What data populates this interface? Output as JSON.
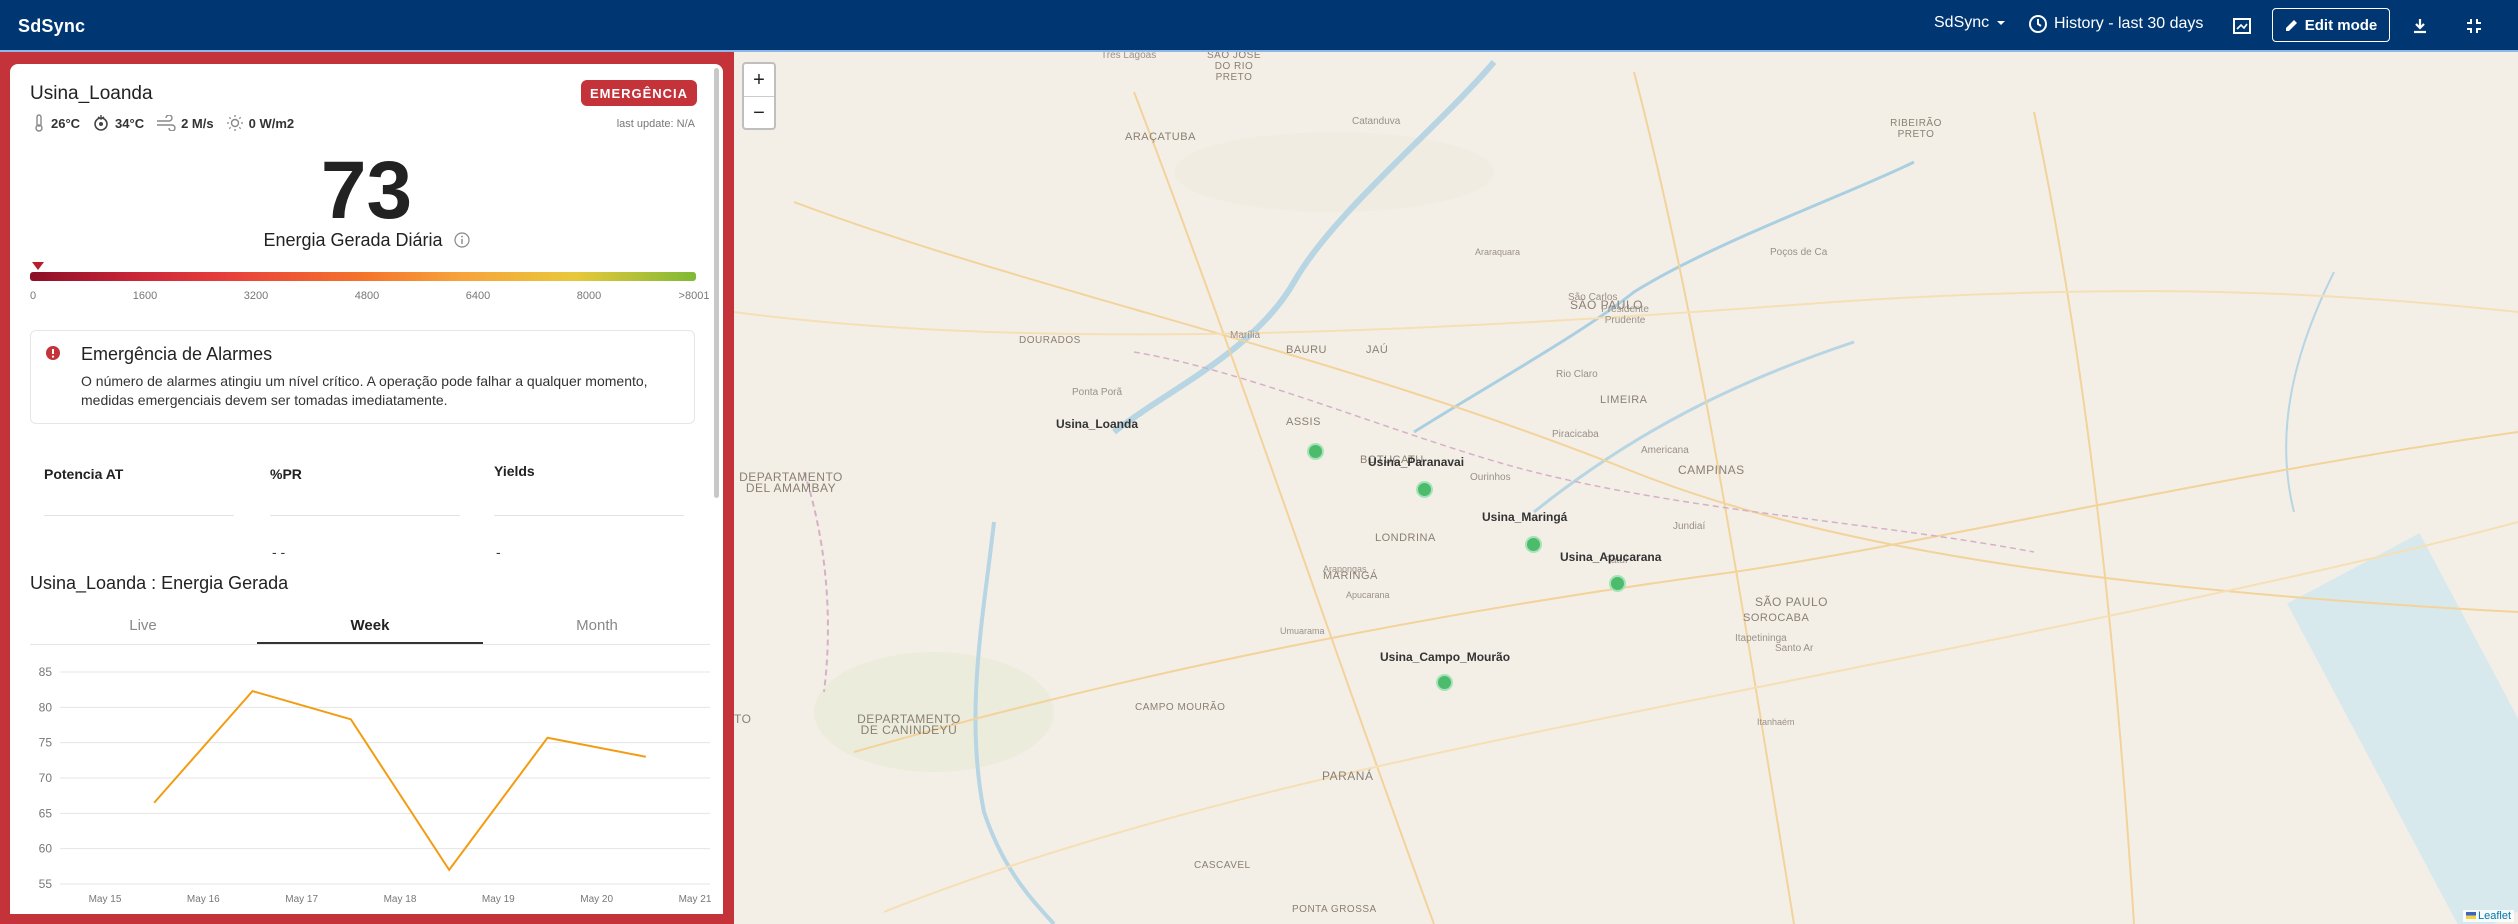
{
  "topbar": {
    "brand": "SdSync",
    "dashboard_select": "SdSync",
    "history": "History - last 30 days",
    "edit_mode": "Edit mode"
  },
  "site": {
    "name": "Usina_Loanda",
    "badge": "EMERGÊNCIA",
    "weather": {
      "temp_air": "26°C",
      "temp_module": "34°C",
      "wind": "2 M/s",
      "irradiance": "0 W/m2"
    },
    "last_update": "last update: N/A"
  },
  "gauge": {
    "value": "73",
    "label": "Energia Gerada Diária",
    "ticks": [
      "0",
      "1600",
      "3200",
      "4800",
      "6400",
      "8000",
      ">8001"
    ]
  },
  "alarm": {
    "title": "Emergência de Alarmes",
    "text": "O número de alarmes atingiu um nível crítico. A operação pode falhar a qualquer momento, medidas emergenciais devem ser tomadas imediatamente."
  },
  "kpis": [
    {
      "label": "Potencia AT",
      "value": ""
    },
    {
      "label": "%PR",
      "value": "- -"
    },
    {
      "label": "Yields",
      "value": "-"
    }
  ],
  "chart_section": {
    "title": "Usina_Loanda : Energia Gerada",
    "tabs": [
      "Live",
      "Week",
      "Month"
    ],
    "active_tab": "Week"
  },
  "chart_data": {
    "type": "line",
    "categories": [
      "May 15",
      "May 16",
      "May 17",
      "May 18",
      "May 19",
      "May 20",
      "May 21"
    ],
    "x": [
      "May 15 12:00",
      "May 16 12:00",
      "May 17 12:00",
      "May 18 12:00",
      "May 19 12:00",
      "May 20 12:00",
      "May 21 12:00"
    ],
    "series": [
      {
        "values": [
          66.5,
          82.3,
          78.3,
          57.0,
          75.7,
          73.0
        ],
        "color": "#f39c12"
      }
    ],
    "yticks": [
      "85",
      "80",
      "75",
      "70",
      "65",
      "60",
      "55"
    ],
    "ylim": [
      55,
      85
    ],
    "grid": true
  },
  "map": {
    "zoom_in": "+",
    "zoom_out": "−",
    "attribution": "Leaflet",
    "markers": [
      {
        "name": "Usina_Loanda"
      },
      {
        "name": "Usina_Paranavai"
      },
      {
        "name": "Usina_Maringá"
      },
      {
        "name": "Usina_Apucarana"
      },
      {
        "name": "Usina_Campo_Mourão"
      }
    ],
    "labels": [
      "Três Lagoas",
      "SÃO JOSÉ DO RIO PRETO",
      "Catanduva",
      "RIBEIRÃO PRETO",
      "ARAÇATUBA",
      "Araraquara",
      "Poços de Ca",
      "SÃO PAULO",
      "São Carlos",
      "Presidente Prudente",
      "Marília",
      "BAURU",
      "JAÚ",
      "Rio Claro",
      "LIMEIRA",
      "DOURADOS",
      "Ponta Porã",
      "ASSIS",
      "Ourinhos",
      "BOTUCATU",
      "Piracicaba",
      "Americana",
      "CAMPINAS",
      "DEPARTAMENTO DEL AMAMBAY",
      "LONDRINA",
      "Arapongas",
      "Apucarana",
      "Tatuí",
      "Jundiaí",
      "MARINGÁ",
      "Umuarama",
      "SOROCABA",
      "SÃO PAULO",
      "Itapetininga",
      "Santo Ar",
      "DEPARTAMENTO DE CANINDEYÚ",
      "CAMPO MOURÃO",
      "Itanhaém",
      "PARANÁ",
      "CASCAVEL",
      "PONTA GROSSA",
      "TO"
    ]
  }
}
